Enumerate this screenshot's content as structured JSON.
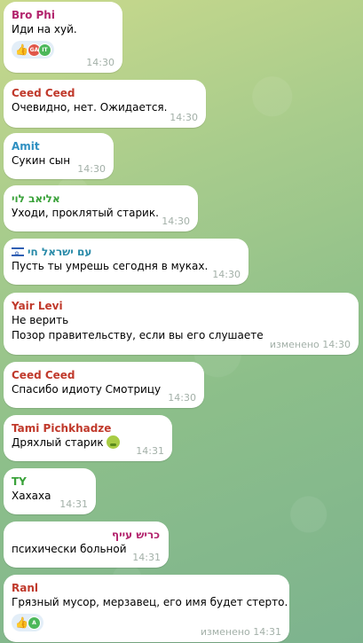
{
  "colors": {
    "bubble": "#ffffff",
    "timestamp": "#a3b0a8",
    "reaction_pill": "#e3eef8"
  },
  "messages": [
    {
      "sender": "Bro Phi",
      "sender_color": "#b3246d",
      "text": "Иди на хуй.",
      "time": "14:30",
      "reactions": {
        "emoji": "👍",
        "avatars": [
          {
            "initials": "GA",
            "color": "#e0584a"
          },
          {
            "initials": "IT",
            "color": "#4cb85a"
          }
        ]
      }
    },
    {
      "sender": "Ceed Ceed",
      "sender_color": "#c0392b",
      "text": "Очевидно, нет. Ожидается.",
      "time": "14:30"
    },
    {
      "sender": "Amit",
      "sender_color": "#2e8fc1",
      "text": "Сукин сын",
      "time": "14:30"
    },
    {
      "sender": "אליאב לוי",
      "sender_color": "#3aa23a",
      "text": "Уходи, проклятый старик.",
      "time": "14:30"
    },
    {
      "sender": "עם ישראל חי",
      "sender_color": "#2a8ba9",
      "flag": "israel-flag",
      "text": "Пусть ты умрешь сегодня в муках.",
      "time": "14:30"
    },
    {
      "sender": "Yair Levi",
      "sender_color": "#c0392b",
      "text": "Не верить",
      "text2": "Позор правительству, если вы его слушаете",
      "edited": "изменено",
      "time": "14:30"
    },
    {
      "sender": "Ceed Ceed",
      "sender_color": "#c0392b",
      "text": "Спасибо идиоту Смотрицу",
      "time": "14:30"
    },
    {
      "sender": "Tami Pichkhadze",
      "sender_color": "#c0392b",
      "text": "Дряхлый старик",
      "emoji": "sick-face",
      "time": "14:31"
    },
    {
      "sender": "TY",
      "sender_color": "#3aa23a",
      "text": "Хахаха",
      "time": "14:31"
    },
    {
      "sender": "כריש עייף",
      "sender_color": "#b3246d",
      "text": "психически больной",
      "time": "14:31"
    },
    {
      "sender": "Ranl",
      "sender_color": "#c0392b",
      "text": "Грязный мусор, мерзавец, его имя будет стерто.",
      "edited": "изменено",
      "time": "14:31",
      "reactions": {
        "emoji": "👍",
        "avatars": [
          {
            "initials": "A",
            "color": "#4cb85a"
          }
        ]
      }
    }
  ]
}
